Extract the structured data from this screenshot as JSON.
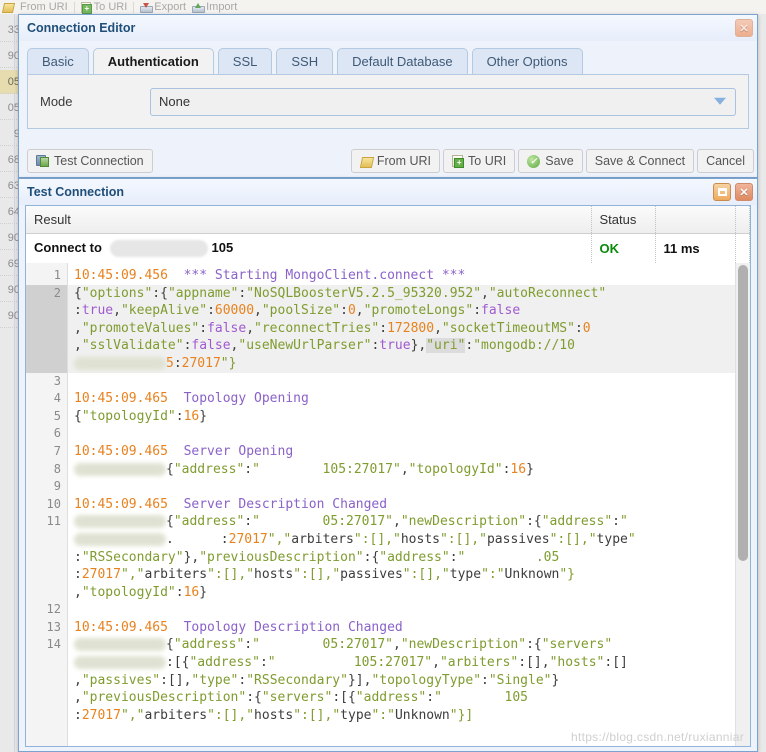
{
  "background": {
    "toolbar_items": [
      {
        "label": "From URI",
        "icon": "pencil-icon"
      },
      {
        "label": "To URI",
        "icon": "clipboard-plus-icon"
      },
      {
        "label": "Export",
        "icon": "export-icon"
      },
      {
        "label": "Import",
        "icon": "import-icon"
      }
    ],
    "row_numbers": [
      "33",
      "90",
      "05",
      "05",
      "9",
      "68",
      "63",
      "64",
      "90",
      "69",
      "90",
      "90"
    ],
    "highlighted_row_index": 2
  },
  "connection_editor": {
    "title": "Connection Editor",
    "close_label": "✕",
    "tabs": [
      {
        "label": "Basic",
        "active": false
      },
      {
        "label": "Authentication",
        "active": true
      },
      {
        "label": "SSL",
        "active": false
      },
      {
        "label": "SSH",
        "active": false
      },
      {
        "label": "Default Database",
        "active": false
      },
      {
        "label": "Other Options",
        "active": false
      }
    ],
    "mode_label": "Mode",
    "mode_value": "None",
    "buttons": [
      {
        "label": "Test Connection",
        "icon": "test-connection-icon"
      },
      {
        "label": "From URI",
        "icon": "pencil-icon"
      },
      {
        "label": "To URI",
        "icon": "clipboard-plus-icon"
      },
      {
        "label": "Save",
        "icon": "save-check-icon"
      },
      {
        "label": "Save & Connect",
        "icon": "none"
      },
      {
        "label": "Cancel",
        "icon": "none"
      }
    ]
  },
  "test_connection": {
    "title": "Test Connection",
    "maximize_label": "□",
    "close_label": "✕",
    "columns": [
      "Result",
      "Status",
      ""
    ],
    "row": {
      "result_prefix": "Connect to",
      "result_redacted": true,
      "result_suffix": "105",
      "status": "OK",
      "duration": "11 ms"
    },
    "scroll_position": "top",
    "watermark": "https://blog.csdn.net/ruxianniar",
    "log_lines": [
      {
        "n": "1",
        "selected": false,
        "type": "event",
        "time": "10:45:09.456",
        "event": "*** Starting MongoClient.connect ***"
      },
      {
        "n": "2",
        "selected": true,
        "type": "json",
        "text": "{\"options\":{\"appname\":\"NoSQLBoosterV5.2.5_95320.952\",\"autoReconnect\""
      },
      {
        "n": "",
        "selected": true,
        "type": "json",
        "text": ":true,\"keepAlive\":60000,\"poolSize\":0,\"promoteLongs\":false"
      },
      {
        "n": "",
        "selected": true,
        "type": "json",
        "text": ",\"promoteValues\":false,\"reconnectTries\":172800,\"socketTimeoutMS\":0"
      },
      {
        "n": "",
        "selected": true,
        "type": "json",
        "text": ",\"sslValidate\":false,\"useNewUrlParser\":true},\"uri\":\"mongodb://10"
      },
      {
        "n": "",
        "selected": true,
        "type": "json-redacted",
        "text": "5:27017\"}"
      },
      {
        "n": "3",
        "selected": false,
        "type": "blank",
        "text": ""
      },
      {
        "n": "4",
        "selected": false,
        "type": "event",
        "time": "10:45:09.465",
        "event": "Topology Opening"
      },
      {
        "n": "5",
        "selected": false,
        "type": "json",
        "text": "{\"topologyId\":16}"
      },
      {
        "n": "6",
        "selected": false,
        "type": "blank",
        "text": ""
      },
      {
        "n": "7",
        "selected": false,
        "type": "event",
        "time": "10:45:09.465",
        "event": "Server Opening"
      },
      {
        "n": "8",
        "selected": false,
        "type": "json-redacted",
        "text": "{\"address\":\"        105:27017\",\"topologyId\":16}"
      },
      {
        "n": "9",
        "selected": false,
        "type": "blank",
        "text": ""
      },
      {
        "n": "10",
        "selected": false,
        "type": "event",
        "time": "10:45:09.465",
        "event": "Server Description Changed"
      },
      {
        "n": "11",
        "selected": false,
        "type": "json-redacted",
        "text": "{\"address\":\"        05:27017\",\"newDescription\":{\"address\":\""
      },
      {
        "n": "",
        "selected": false,
        "type": "json-redacted",
        "text": ".      :27017\",\"arbiters\":[],\"hosts\":[],\"passives\":[],\"type\""
      },
      {
        "n": "",
        "selected": false,
        "type": "json",
        "text": ":\"RSSecondary\"},\"previousDescription\":{\"address\":\"         .05"
      },
      {
        "n": "",
        "selected": false,
        "type": "json",
        "text": ":27017\",\"arbiters\":[],\"hosts\":[],\"passives\":[],\"type\":\"Unknown\"}"
      },
      {
        "n": "",
        "selected": false,
        "type": "json",
        "text": ",\"topologyId\":16}"
      },
      {
        "n": "12",
        "selected": false,
        "type": "blank",
        "text": ""
      },
      {
        "n": "13",
        "selected": false,
        "type": "event",
        "time": "10:45:09.465",
        "event": "Topology Description Changed"
      },
      {
        "n": "14",
        "selected": false,
        "type": "json-redacted",
        "text": "{\"address\":\"        05:27017\",\"newDescription\":{\"servers\""
      },
      {
        "n": "",
        "selected": false,
        "type": "json-redacted",
        "text": ":[{\"address\":\"          105:27017\",\"arbiters\":[],\"hosts\":[]"
      },
      {
        "n": "",
        "selected": false,
        "type": "json",
        "text": ",\"passives\":[],\"type\":\"RSSecondary\"}],\"topologyType\":\"Single\"}"
      },
      {
        "n": "",
        "selected": false,
        "type": "json",
        "text": ",\"previousDescription\":{\"servers\":[{\"address\":\"        105"
      },
      {
        "n": "",
        "selected": false,
        "type": "json",
        "text": ":27017\",\"arbiters\":[],\"hosts\":[],\"type\":\"Unknown\"}]"
      }
    ]
  },
  "colors": {
    "accent": "#1f4e79",
    "ok": "#0a8a0a",
    "timestamp": "#e8821e",
    "event": "#8a62c8",
    "string": "#7f9c2f",
    "keyword": "#a05ad0",
    "tab_active_bg": "#f2f2f2",
    "dialog_border": "#7ba3d0"
  }
}
